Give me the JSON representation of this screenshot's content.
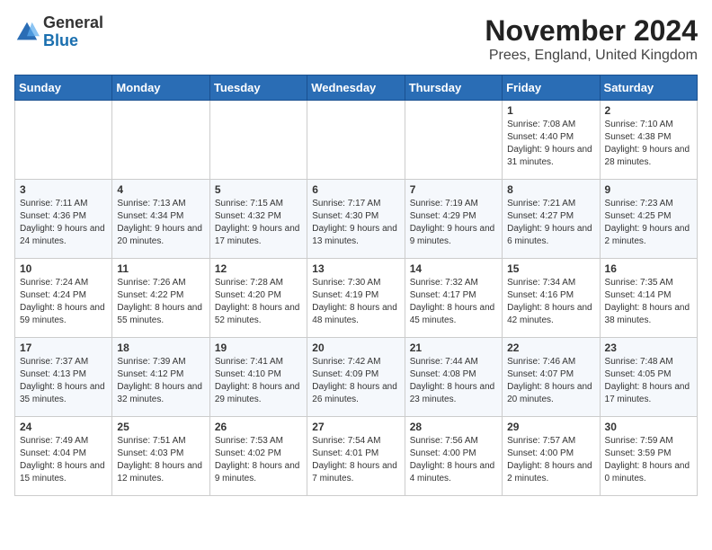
{
  "header": {
    "logo_general": "General",
    "logo_blue": "Blue",
    "month_title": "November 2024",
    "location": "Prees, England, United Kingdom"
  },
  "weekdays": [
    "Sunday",
    "Monday",
    "Tuesday",
    "Wednesday",
    "Thursday",
    "Friday",
    "Saturday"
  ],
  "weeks": [
    [
      {
        "day": "",
        "info": ""
      },
      {
        "day": "",
        "info": ""
      },
      {
        "day": "",
        "info": ""
      },
      {
        "day": "",
        "info": ""
      },
      {
        "day": "",
        "info": ""
      },
      {
        "day": "1",
        "info": "Sunrise: 7:08 AM\nSunset: 4:40 PM\nDaylight: 9 hours and 31 minutes."
      },
      {
        "day": "2",
        "info": "Sunrise: 7:10 AM\nSunset: 4:38 PM\nDaylight: 9 hours and 28 minutes."
      }
    ],
    [
      {
        "day": "3",
        "info": "Sunrise: 7:11 AM\nSunset: 4:36 PM\nDaylight: 9 hours and 24 minutes."
      },
      {
        "day": "4",
        "info": "Sunrise: 7:13 AM\nSunset: 4:34 PM\nDaylight: 9 hours and 20 minutes."
      },
      {
        "day": "5",
        "info": "Sunrise: 7:15 AM\nSunset: 4:32 PM\nDaylight: 9 hours and 17 minutes."
      },
      {
        "day": "6",
        "info": "Sunrise: 7:17 AM\nSunset: 4:30 PM\nDaylight: 9 hours and 13 minutes."
      },
      {
        "day": "7",
        "info": "Sunrise: 7:19 AM\nSunset: 4:29 PM\nDaylight: 9 hours and 9 minutes."
      },
      {
        "day": "8",
        "info": "Sunrise: 7:21 AM\nSunset: 4:27 PM\nDaylight: 9 hours and 6 minutes."
      },
      {
        "day": "9",
        "info": "Sunrise: 7:23 AM\nSunset: 4:25 PM\nDaylight: 9 hours and 2 minutes."
      }
    ],
    [
      {
        "day": "10",
        "info": "Sunrise: 7:24 AM\nSunset: 4:24 PM\nDaylight: 8 hours and 59 minutes."
      },
      {
        "day": "11",
        "info": "Sunrise: 7:26 AM\nSunset: 4:22 PM\nDaylight: 8 hours and 55 minutes."
      },
      {
        "day": "12",
        "info": "Sunrise: 7:28 AM\nSunset: 4:20 PM\nDaylight: 8 hours and 52 minutes."
      },
      {
        "day": "13",
        "info": "Sunrise: 7:30 AM\nSunset: 4:19 PM\nDaylight: 8 hours and 48 minutes."
      },
      {
        "day": "14",
        "info": "Sunrise: 7:32 AM\nSunset: 4:17 PM\nDaylight: 8 hours and 45 minutes."
      },
      {
        "day": "15",
        "info": "Sunrise: 7:34 AM\nSunset: 4:16 PM\nDaylight: 8 hours and 42 minutes."
      },
      {
        "day": "16",
        "info": "Sunrise: 7:35 AM\nSunset: 4:14 PM\nDaylight: 8 hours and 38 minutes."
      }
    ],
    [
      {
        "day": "17",
        "info": "Sunrise: 7:37 AM\nSunset: 4:13 PM\nDaylight: 8 hours and 35 minutes."
      },
      {
        "day": "18",
        "info": "Sunrise: 7:39 AM\nSunset: 4:12 PM\nDaylight: 8 hours and 32 minutes."
      },
      {
        "day": "19",
        "info": "Sunrise: 7:41 AM\nSunset: 4:10 PM\nDaylight: 8 hours and 29 minutes."
      },
      {
        "day": "20",
        "info": "Sunrise: 7:42 AM\nSunset: 4:09 PM\nDaylight: 8 hours and 26 minutes."
      },
      {
        "day": "21",
        "info": "Sunrise: 7:44 AM\nSunset: 4:08 PM\nDaylight: 8 hours and 23 minutes."
      },
      {
        "day": "22",
        "info": "Sunrise: 7:46 AM\nSunset: 4:07 PM\nDaylight: 8 hours and 20 minutes."
      },
      {
        "day": "23",
        "info": "Sunrise: 7:48 AM\nSunset: 4:05 PM\nDaylight: 8 hours and 17 minutes."
      }
    ],
    [
      {
        "day": "24",
        "info": "Sunrise: 7:49 AM\nSunset: 4:04 PM\nDaylight: 8 hours and 15 minutes."
      },
      {
        "day": "25",
        "info": "Sunrise: 7:51 AM\nSunset: 4:03 PM\nDaylight: 8 hours and 12 minutes."
      },
      {
        "day": "26",
        "info": "Sunrise: 7:53 AM\nSunset: 4:02 PM\nDaylight: 8 hours and 9 minutes."
      },
      {
        "day": "27",
        "info": "Sunrise: 7:54 AM\nSunset: 4:01 PM\nDaylight: 8 hours and 7 minutes."
      },
      {
        "day": "28",
        "info": "Sunrise: 7:56 AM\nSunset: 4:00 PM\nDaylight: 8 hours and 4 minutes."
      },
      {
        "day": "29",
        "info": "Sunrise: 7:57 AM\nSunset: 4:00 PM\nDaylight: 8 hours and 2 minutes."
      },
      {
        "day": "30",
        "info": "Sunrise: 7:59 AM\nSunset: 3:59 PM\nDaylight: 8 hours and 0 minutes."
      }
    ]
  ]
}
